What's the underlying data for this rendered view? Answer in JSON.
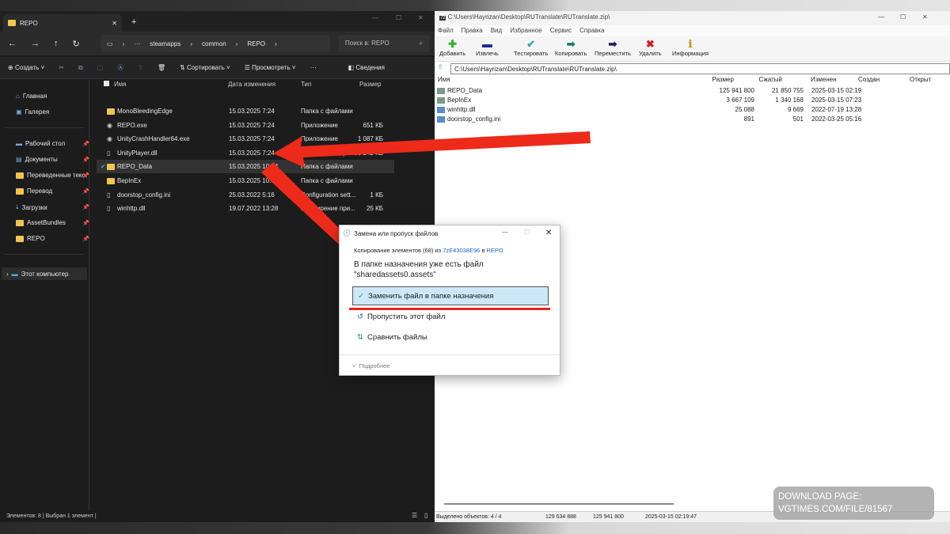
{
  "explorer": {
    "tab_title": "REPO",
    "breadcrumb": [
      "steamapps",
      "common",
      "REPO"
    ],
    "search_placeholder": "Поиск в: REPO",
    "toolbar": {
      "create": "Создать",
      "sort": "Сортировать",
      "view": "Просмотреть",
      "details": "Сведения"
    },
    "sidebar": {
      "items": [
        {
          "label": "Главная",
          "icon": "home-icon"
        },
        {
          "label": "Галерея",
          "icon": "gallery-icon"
        },
        {
          "label": "Рабочий стол",
          "icon": "desktop-icon"
        },
        {
          "label": "Документы",
          "icon": "documents-icon"
        },
        {
          "label": "Переведенные текс",
          "icon": "folder-icon"
        },
        {
          "label": "Перевод",
          "icon": "folder-icon"
        },
        {
          "label": "Загрузки",
          "icon": "download-icon"
        },
        {
          "label": "AssetBundles",
          "icon": "folder-icon"
        },
        {
          "label": "REPO",
          "icon": "folder-icon"
        }
      ],
      "this_pc": "Этот компьютер"
    },
    "columns": [
      "Имя",
      "Дата изменения",
      "Тип",
      "Размер"
    ],
    "files": [
      {
        "name": "MonoBleedingEdge",
        "date": "15.03.2025 7:24",
        "type": "Папка с файлами",
        "size": "",
        "icon": "folder"
      },
      {
        "name": "REPO.exe",
        "date": "15.03.2025 7:24",
        "type": "Приложение",
        "size": "651 КБ",
        "icon": "exe"
      },
      {
        "name": "UnityCrashHandler64.exe",
        "date": "15.03.2025 7:24",
        "type": "Приложение",
        "size": "1 087 КБ",
        "icon": "exe"
      },
      {
        "name": "UnityPlayer.dll",
        "date": "15.03.2025 7:24",
        "type": "Расширение при...",
        "size": "30 242 КБ",
        "icon": "file"
      },
      {
        "name": "REPO_Data",
        "date": "15.03.2025 10:34",
        "type": "Папка с файлами",
        "size": "",
        "icon": "folder",
        "selected": true
      },
      {
        "name": "BepInEx",
        "date": "15.03.2025 10:34",
        "type": "Папка с файлами",
        "size": "",
        "icon": "folder"
      },
      {
        "name": "doorstop_config.ini",
        "date": "25.03.2022 5:16",
        "type": "Configuration sett...",
        "size": "1 КБ",
        "icon": "file"
      },
      {
        "name": "winhttp.dll",
        "date": "19.07.2022 13:28",
        "type": "Расширение при...",
        "size": "25 КБ",
        "icon": "file"
      }
    ],
    "status": "Элементов: 8  |  Выбран 1 элемент  |"
  },
  "zip": {
    "title": "C:\\Users\\Hayrizan\\Desktop\\RUTranslate\\RUTranslate.zip\\",
    "menu": [
      "Файл",
      "Правка",
      "Вид",
      "Избранное",
      "Сервис",
      "Справка"
    ],
    "toolbar": [
      {
        "label": "Добавить",
        "icon": "add-icon",
        "color": "#2db52d"
      },
      {
        "label": "Извлечь",
        "icon": "extract-icon",
        "color": "#1a2a9a"
      },
      {
        "label": "Тестировать",
        "icon": "test-icon",
        "color": "#2aa8b8"
      },
      {
        "label": "Копировать",
        "icon": "copy-icon",
        "color": "#1a7a6a"
      },
      {
        "label": "Переместить",
        "icon": "move-icon",
        "color": "#1a1a6a"
      },
      {
        "label": "Удалить",
        "icon": "delete-icon",
        "color": "#d02020"
      },
      {
        "label": "Информация",
        "icon": "info-icon",
        "color": "#c8a010"
      }
    ],
    "address": "C:\\Users\\Hayrizan\\Desktop\\RUTranslate\\RUTranslate.zip\\",
    "columns": [
      "Имя",
      "Размер",
      "Сжатый",
      "Изменен",
      "Создан",
      "Открыт"
    ],
    "files": [
      {
        "name": "REPO_Data",
        "size": "125 941 800",
        "packed": "21 850 755",
        "modified": "2025-03-15 02:19"
      },
      {
        "name": "BepInEx",
        "size": "3 667 109",
        "packed": "1 340 168",
        "modified": "2025-03-15 07:23"
      },
      {
        "name": "winhttp.dll",
        "size": "25 088",
        "packed": "9 669",
        "modified": "2022-07-19 13:28"
      },
      {
        "name": "doorstop_config.ini",
        "size": "891",
        "packed": "501",
        "modified": "2022-03-25 05:16"
      }
    ],
    "status": {
      "selected": "Выделено объектов: 4 / 4",
      "a": "129 634 888",
      "b": "125 941 800",
      "date": "2025-03-15 02:19:47"
    }
  },
  "dialog": {
    "title": "Замена или пропуск файлов",
    "progress_prefix": "Копирование элементов (68) из ",
    "source": "7zE43038E96",
    "mid": " в ",
    "dest": "REPO",
    "message1": "В папке назначения уже есть файл",
    "message2": "\"sharedassets0.assets\"",
    "replace": "Заменить файл в папке назначения",
    "skip": "Пропустить этот файл",
    "compare": "Сравнить файлы",
    "more": "Подробнее",
    "link_color": "#1a6bb8"
  },
  "watermark": {
    "brand": "VGTimes",
    "download": "DOWNLOAD PAGE:",
    "url": "VGTIMES.COM/FILE/81567"
  },
  "arrow_color": "#ee2a1a"
}
